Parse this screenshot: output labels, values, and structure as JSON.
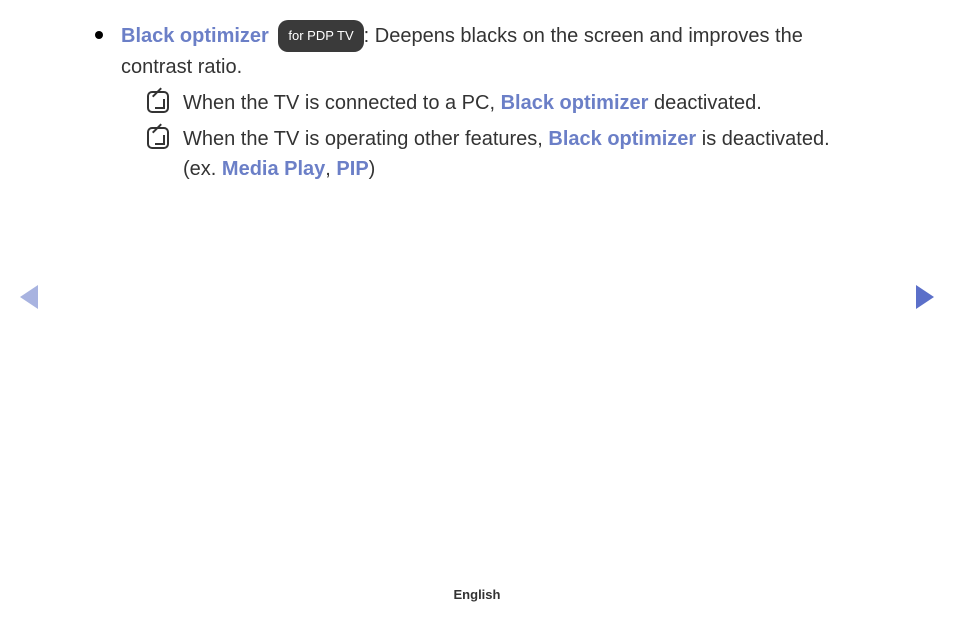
{
  "main": {
    "feature_title": "Black optimizer",
    "badge": "for PDP TV",
    "desc_prefix": ": ",
    "desc": "Deepens blacks on the screen and improves the contrast ratio.",
    "notes": [
      {
        "before": "When the TV is connected to a PC, ",
        "feature1": "Black optimizer",
        "after": " deactivated."
      },
      {
        "before": "When the TV is operating other features, ",
        "feature1": "Black optimizer",
        "mid": " is deactivated. (ex. ",
        "feature2": "Media Play",
        "sep": ", ",
        "feature3": "PIP",
        "after": ")"
      }
    ]
  },
  "footer": {
    "language": "English"
  }
}
